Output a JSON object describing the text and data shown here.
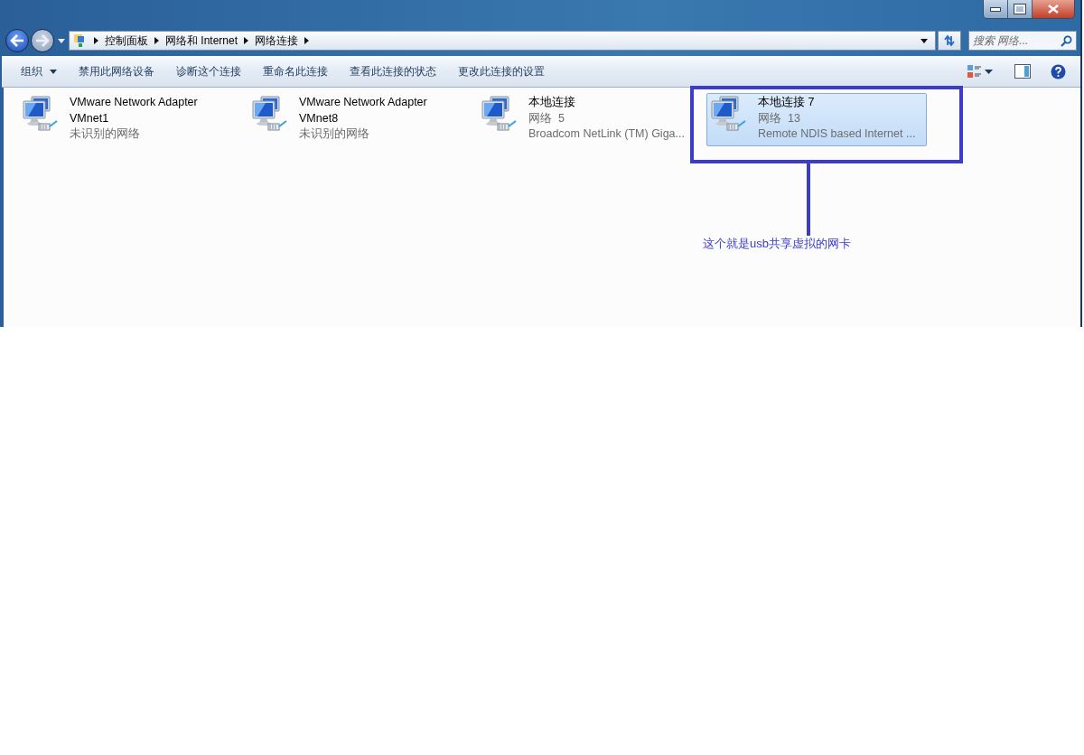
{
  "breadcrumb": [
    "控制面板",
    "网络和 Internet",
    "网络连接"
  ],
  "search": {
    "placeholder": "搜索 网络..."
  },
  "toolbar": [
    {
      "label": "组织",
      "dropdown": true
    },
    {
      "label": "禁用此网络设备",
      "dropdown": false
    },
    {
      "label": "诊断这个连接",
      "dropdown": false
    },
    {
      "label": "重命名此连接",
      "dropdown": false
    },
    {
      "label": "查看此连接的状态",
      "dropdown": false
    },
    {
      "label": "更改此连接的设置",
      "dropdown": false
    }
  ],
  "adapters": [
    {
      "name": "VMware Network Adapter VMnet1",
      "status": "未识别的网络",
      "selected": false
    },
    {
      "name": "VMware Network Adapter VMnet8",
      "status": "未识别的网络",
      "selected": false
    },
    {
      "name": "本地连接",
      "status": "网络  5",
      "device": "Broadcom NetLink (TM) Giga...",
      "selected": false
    },
    {
      "name": "本地连接 7",
      "status": "网络  13",
      "device": "Remote NDIS based Internet ...",
      "selected": true
    }
  ],
  "annotation": {
    "text": "这个就是usb共享虚拟的网卡"
  }
}
